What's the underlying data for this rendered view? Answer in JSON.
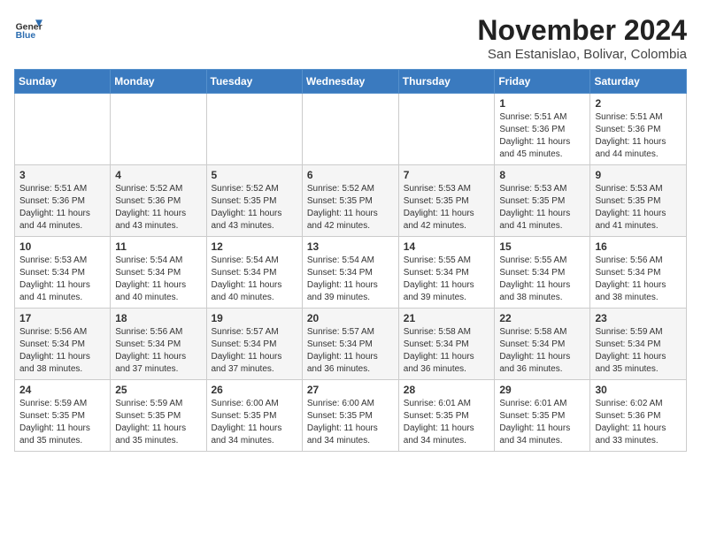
{
  "header": {
    "logo": {
      "general": "General",
      "blue": "Blue"
    },
    "month": "November 2024",
    "location": "San Estanislao, Bolivar, Colombia"
  },
  "days_of_week": [
    "Sunday",
    "Monday",
    "Tuesday",
    "Wednesday",
    "Thursday",
    "Friday",
    "Saturday"
  ],
  "weeks": [
    [
      {
        "num": "",
        "info": ""
      },
      {
        "num": "",
        "info": ""
      },
      {
        "num": "",
        "info": ""
      },
      {
        "num": "",
        "info": ""
      },
      {
        "num": "",
        "info": ""
      },
      {
        "num": "1",
        "info": "Sunrise: 5:51 AM\nSunset: 5:36 PM\nDaylight: 11 hours\nand 45 minutes."
      },
      {
        "num": "2",
        "info": "Sunrise: 5:51 AM\nSunset: 5:36 PM\nDaylight: 11 hours\nand 44 minutes."
      }
    ],
    [
      {
        "num": "3",
        "info": "Sunrise: 5:51 AM\nSunset: 5:36 PM\nDaylight: 11 hours\nand 44 minutes."
      },
      {
        "num": "4",
        "info": "Sunrise: 5:52 AM\nSunset: 5:36 PM\nDaylight: 11 hours\nand 43 minutes."
      },
      {
        "num": "5",
        "info": "Sunrise: 5:52 AM\nSunset: 5:35 PM\nDaylight: 11 hours\nand 43 minutes."
      },
      {
        "num": "6",
        "info": "Sunrise: 5:52 AM\nSunset: 5:35 PM\nDaylight: 11 hours\nand 42 minutes."
      },
      {
        "num": "7",
        "info": "Sunrise: 5:53 AM\nSunset: 5:35 PM\nDaylight: 11 hours\nand 42 minutes."
      },
      {
        "num": "8",
        "info": "Sunrise: 5:53 AM\nSunset: 5:35 PM\nDaylight: 11 hours\nand 41 minutes."
      },
      {
        "num": "9",
        "info": "Sunrise: 5:53 AM\nSunset: 5:35 PM\nDaylight: 11 hours\nand 41 minutes."
      }
    ],
    [
      {
        "num": "10",
        "info": "Sunrise: 5:53 AM\nSunset: 5:34 PM\nDaylight: 11 hours\nand 41 minutes."
      },
      {
        "num": "11",
        "info": "Sunrise: 5:54 AM\nSunset: 5:34 PM\nDaylight: 11 hours\nand 40 minutes."
      },
      {
        "num": "12",
        "info": "Sunrise: 5:54 AM\nSunset: 5:34 PM\nDaylight: 11 hours\nand 40 minutes."
      },
      {
        "num": "13",
        "info": "Sunrise: 5:54 AM\nSunset: 5:34 PM\nDaylight: 11 hours\nand 39 minutes."
      },
      {
        "num": "14",
        "info": "Sunrise: 5:55 AM\nSunset: 5:34 PM\nDaylight: 11 hours\nand 39 minutes."
      },
      {
        "num": "15",
        "info": "Sunrise: 5:55 AM\nSunset: 5:34 PM\nDaylight: 11 hours\nand 38 minutes."
      },
      {
        "num": "16",
        "info": "Sunrise: 5:56 AM\nSunset: 5:34 PM\nDaylight: 11 hours\nand 38 minutes."
      }
    ],
    [
      {
        "num": "17",
        "info": "Sunrise: 5:56 AM\nSunset: 5:34 PM\nDaylight: 11 hours\nand 38 minutes."
      },
      {
        "num": "18",
        "info": "Sunrise: 5:56 AM\nSunset: 5:34 PM\nDaylight: 11 hours\nand 37 minutes."
      },
      {
        "num": "19",
        "info": "Sunrise: 5:57 AM\nSunset: 5:34 PM\nDaylight: 11 hours\nand 37 minutes."
      },
      {
        "num": "20",
        "info": "Sunrise: 5:57 AM\nSunset: 5:34 PM\nDaylight: 11 hours\nand 36 minutes."
      },
      {
        "num": "21",
        "info": "Sunrise: 5:58 AM\nSunset: 5:34 PM\nDaylight: 11 hours\nand 36 minutes."
      },
      {
        "num": "22",
        "info": "Sunrise: 5:58 AM\nSunset: 5:34 PM\nDaylight: 11 hours\nand 36 minutes."
      },
      {
        "num": "23",
        "info": "Sunrise: 5:59 AM\nSunset: 5:34 PM\nDaylight: 11 hours\nand 35 minutes."
      }
    ],
    [
      {
        "num": "24",
        "info": "Sunrise: 5:59 AM\nSunset: 5:35 PM\nDaylight: 11 hours\nand 35 minutes."
      },
      {
        "num": "25",
        "info": "Sunrise: 5:59 AM\nSunset: 5:35 PM\nDaylight: 11 hours\nand 35 minutes."
      },
      {
        "num": "26",
        "info": "Sunrise: 6:00 AM\nSunset: 5:35 PM\nDaylight: 11 hours\nand 34 minutes."
      },
      {
        "num": "27",
        "info": "Sunrise: 6:00 AM\nSunset: 5:35 PM\nDaylight: 11 hours\nand 34 minutes."
      },
      {
        "num": "28",
        "info": "Sunrise: 6:01 AM\nSunset: 5:35 PM\nDaylight: 11 hours\nand 34 minutes."
      },
      {
        "num": "29",
        "info": "Sunrise: 6:01 AM\nSunset: 5:35 PM\nDaylight: 11 hours\nand 34 minutes."
      },
      {
        "num": "30",
        "info": "Sunrise: 6:02 AM\nSunset: 5:36 PM\nDaylight: 11 hours\nand 33 minutes."
      }
    ]
  ]
}
